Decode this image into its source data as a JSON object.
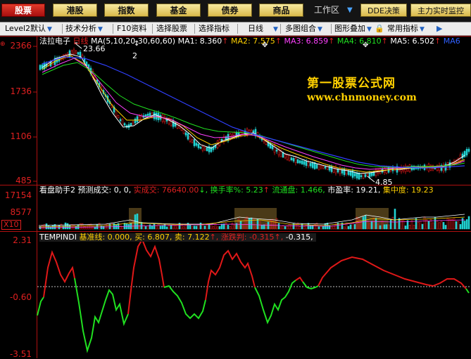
{
  "colors": {
    "up": "#e01818",
    "down": "#21d1d1",
    "green": "#20e020",
    "yellow": "#ffd000",
    "magenta": "#ff40ff",
    "cyan": "#00d0ff",
    "blue": "#3040ff",
    "white": "#ffffff"
  },
  "tabs": [
    {
      "label": "股票",
      "active": true
    },
    {
      "label": "港股"
    },
    {
      "label": "指数"
    },
    {
      "label": "基金"
    },
    {
      "label": "债券"
    },
    {
      "label": "商品"
    }
  ],
  "workspace_label": "工作区",
  "dde_label": "DDE决策",
  "main_monitor_label": "主力实时监控",
  "toolbar": [
    "Level2默认",
    "技术分析",
    "F10资料",
    "选择股票",
    "选择指标",
    "日线",
    "多图组合",
    "图形叠加",
    "常用指标"
  ],
  "price_panel": {
    "stock_name": "法拉电子",
    "period": "日线",
    "ma_params": "MA(5,10,20,30,60,60)",
    "ma1": "MA1: 8.360",
    "ma2": "MA2: 7.575",
    "ma3": "MA3: 6.859",
    "ma4": "MA4: 6.810",
    "ma5": "MA5: 6.502",
    "ma6": "MA6",
    "high_label": "23.66",
    "low_label": "4.85",
    "marker": "2",
    "axis": [
      "2366",
      "1736",
      "1106",
      "485"
    ]
  },
  "watermark": {
    "title": "第一股票公式网",
    "url": "www.chnmoney.com"
  },
  "volume_panel": {
    "name": "看盘助手2",
    "forecast": "预测成交: 0, 0,",
    "actual": "实成交: 76640.00",
    "turnover": "换手率%: 5.23",
    "circulating": "流通盘: 1.466,",
    "pe": "市盈率: 19.21,",
    "concentration": "集中度: 19.23",
    "axis": [
      "17154",
      "8577",
      "X10"
    ]
  },
  "indicator_panel": {
    "name": "TEMPINDI",
    "base": "基准线: 0.000,",
    "buy": "买: 6.807,",
    "sell": "卖: 7.122",
    "trend": "涨跌判: -0.315",
    "trend2": "-0.315,",
    "axis": [
      "2.31",
      "-0.60",
      "-3.51"
    ]
  }
}
